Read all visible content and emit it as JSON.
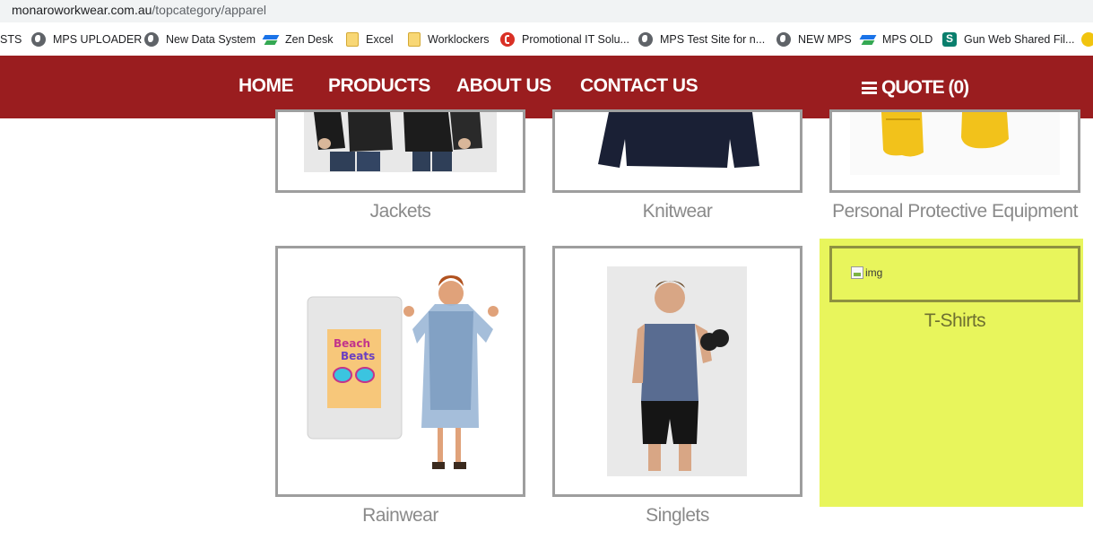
{
  "browser": {
    "url_domain": "monaroworkwear.com.au",
    "url_path": "/topcategory/apparel",
    "bookmarks": [
      {
        "label": "STS",
        "icon": "none"
      },
      {
        "label": "MPS UPLOADER",
        "icon": "globe-icon"
      },
      {
        "label": "New Data System",
        "icon": "globe-icon"
      },
      {
        "label": "Zen Desk",
        "icon": "zendesk-icon"
      },
      {
        "label": "Excel",
        "icon": "folder-icon"
      },
      {
        "label": "Worklockers",
        "icon": "folder-icon"
      },
      {
        "label": "Promotional IT Solu...",
        "icon": "promo-icon"
      },
      {
        "label": "MPS Test Site for n...",
        "icon": "globe-icon"
      },
      {
        "label": "NEW MPS",
        "icon": "globe-icon"
      },
      {
        "label": "MPS OLD",
        "icon": "zendesk-icon"
      },
      {
        "label": "Gun Web Shared Fil...",
        "icon": "sharepoint-icon"
      }
    ]
  },
  "nav": {
    "home": "HOME",
    "products": "PRODUCTS",
    "about": "ABOUT US",
    "contact": "CONTACT US",
    "quote": "QUOTE (0)",
    "bg_color": "#9a1d1f"
  },
  "products": {
    "jackets": "Jackets",
    "knitwear": "Knitwear",
    "ppe": "Personal Protective Equipment",
    "rainwear": "Rainwear",
    "singlets": "Singlets",
    "tshirts": "T-Shirts",
    "broken_img_alt": "img"
  },
  "colors": {
    "highlight": "#e8f55c",
    "tile_border": "#9e9e9e",
    "caption": "#8a8a8a"
  }
}
